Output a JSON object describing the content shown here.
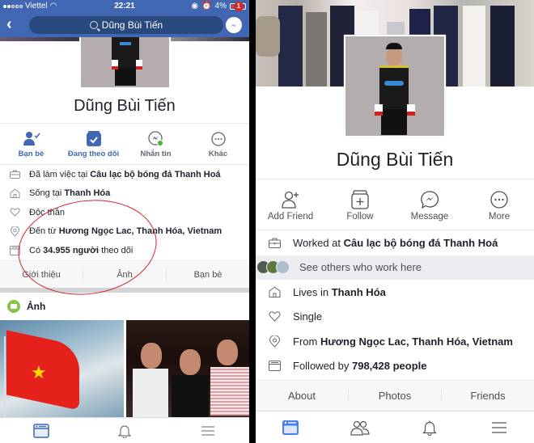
{
  "left_screen": {
    "status_bar": {
      "carrier": "Viettel",
      "time": "22:21",
      "battery": "4%"
    },
    "nav": {
      "search_text": "Dũng Bùi Tiến",
      "messenger_badge": "1"
    },
    "profile": {
      "name": "Dũng Bùi Tiến"
    },
    "actions": [
      {
        "label": "Bạn bè",
        "icon": "friends-check-icon"
      },
      {
        "label": "Đang theo dõi",
        "icon": "following-check-icon"
      },
      {
        "label": "Nhắn tin",
        "icon": "messenger-icon"
      },
      {
        "label": "Khác",
        "icon": "more-icon"
      }
    ],
    "info": [
      {
        "icon": "briefcase-icon",
        "prefix": "Đã làm việc tại ",
        "bold": "Câu lạc bộ bóng đá Thanh Hoá",
        "suffix": ""
      },
      {
        "icon": "home-icon",
        "prefix": "Sống tại ",
        "bold": "Thanh Hóa",
        "suffix": ""
      },
      {
        "icon": "heart-icon",
        "prefix": "Độc thân",
        "bold": "",
        "suffix": ""
      },
      {
        "icon": "location-pin-icon",
        "prefix": "Đến từ ",
        "bold": "Hương Ngọc Lac, Thanh Hóa, Vietnam",
        "suffix": ""
      },
      {
        "icon": "followers-icon",
        "prefix": "Có ",
        "bold": "34.955 người",
        "suffix": " theo dõi"
      }
    ],
    "tabs": [
      "Giới thiệu",
      "Ảnh",
      "Bạn bè"
    ],
    "photos_header": "Ảnh",
    "annotation_color": "#d3242c"
  },
  "right_screen": {
    "profile": {
      "name": "Dũng Bùi Tiến"
    },
    "actions": [
      {
        "label": "Add Friend",
        "icon": "add-friend-icon"
      },
      {
        "label": "Follow",
        "icon": "follow-icon"
      },
      {
        "label": "Message",
        "icon": "messenger-icon"
      },
      {
        "label": "More",
        "icon": "more-icon"
      }
    ],
    "info": {
      "work": {
        "prefix": "Worked at ",
        "bold": "Câu lạc bộ bóng đá Thanh Hoá"
      },
      "coworkers": "See others who work here",
      "lives": {
        "prefix": "Lives in ",
        "bold": "Thanh Hóa"
      },
      "relationship": {
        "prefix": "Single"
      },
      "from": {
        "prefix": "From ",
        "bold": "Hương Ngọc Lac, Thanh Hóa, Vietnam"
      },
      "followers": {
        "prefix": "Followed by ",
        "bold": "798,428 people"
      }
    },
    "tabs": [
      "About",
      "Photos",
      "Friends"
    ]
  },
  "colors": {
    "facebook_blue": "#4267b2",
    "search_bg": "#29487d",
    "badge_red": "#e02424",
    "online_green": "#42b72a"
  }
}
